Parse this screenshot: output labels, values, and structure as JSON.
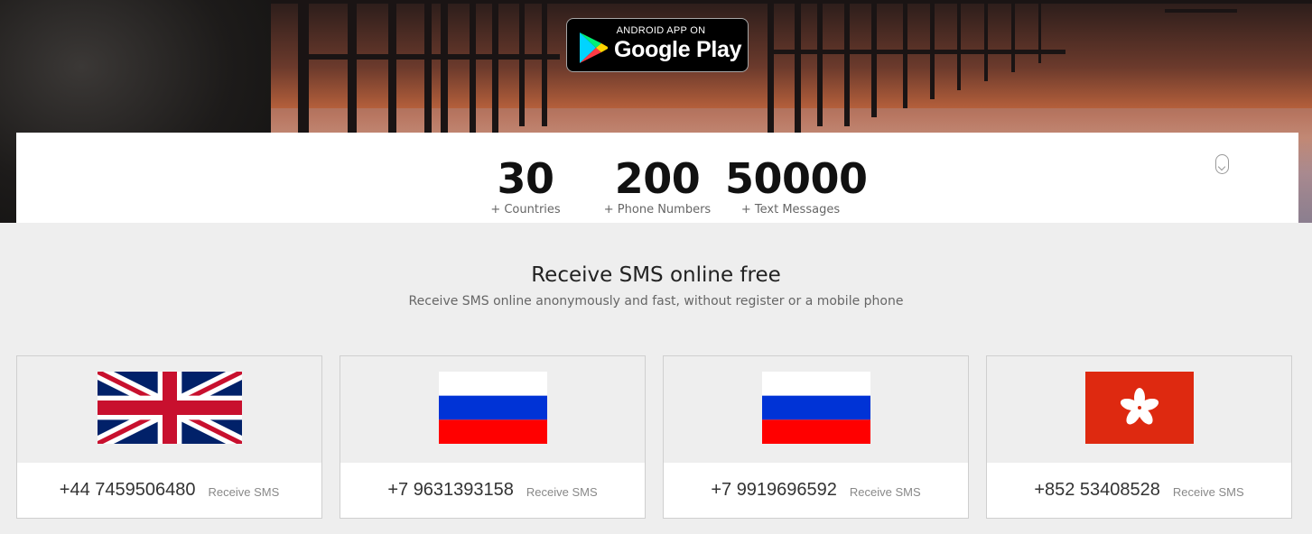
{
  "hero": {
    "badge": {
      "small_text": "ANDROID APP ON",
      "big_text": "Google Play"
    }
  },
  "stats": [
    {
      "number": "30",
      "label": "+ Countries"
    },
    {
      "number": "200",
      "label": "+ Phone Numbers"
    },
    {
      "number": "50000",
      "label": "+ Text Messages"
    }
  ],
  "main": {
    "title": "Receive SMS online free",
    "subtitle": "Receive SMS online anonymously and fast, without register or a mobile phone"
  },
  "cards": [
    {
      "flag": "united-kingdom-flag-icon",
      "phone": "+44 7459506480",
      "action": "Receive SMS"
    },
    {
      "flag": "russia-flag-icon",
      "phone": "+7 9631393158",
      "action": "Receive SMS"
    },
    {
      "flag": "russia-flag-icon",
      "phone": "+7 9919696592",
      "action": "Receive SMS"
    },
    {
      "flag": "hong-kong-flag-icon",
      "phone": "+852 53408528",
      "action": "Receive SMS"
    }
  ]
}
